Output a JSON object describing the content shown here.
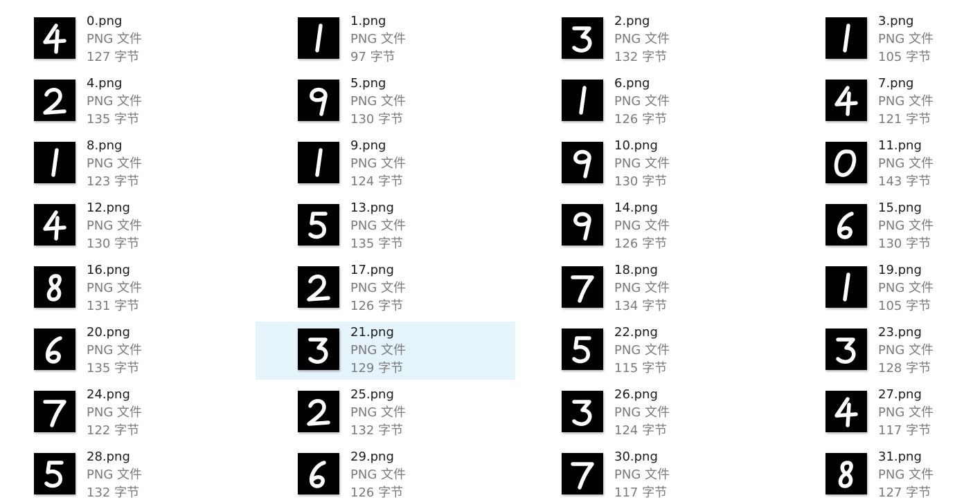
{
  "files": [
    {
      "name": "0.png",
      "type": "PNG 文件",
      "size": "127 字节",
      "digit": "4"
    },
    {
      "name": "1.png",
      "type": "PNG 文件",
      "size": "97 字节",
      "digit": "1"
    },
    {
      "name": "2.png",
      "type": "PNG 文件",
      "size": "132 字节",
      "digit": "3"
    },
    {
      "name": "3.png",
      "type": "PNG 文件",
      "size": "105 字节",
      "digit": "1"
    },
    {
      "name": "4.png",
      "type": "PNG 文件",
      "size": "135 字节",
      "digit": "2"
    },
    {
      "name": "5.png",
      "type": "PNG 文件",
      "size": "130 字节",
      "digit": "9"
    },
    {
      "name": "6.png",
      "type": "PNG 文件",
      "size": "126 字节",
      "digit": "1"
    },
    {
      "name": "7.png",
      "type": "PNG 文件",
      "size": "121 字节",
      "digit": "4"
    },
    {
      "name": "8.png",
      "type": "PNG 文件",
      "size": "123 字节",
      "digit": "1"
    },
    {
      "name": "9.png",
      "type": "PNG 文件",
      "size": "124 字节",
      "digit": "1"
    },
    {
      "name": "10.png",
      "type": "PNG 文件",
      "size": "130 字节",
      "digit": "9"
    },
    {
      "name": "11.png",
      "type": "PNG 文件",
      "size": "143 字节",
      "digit": "0"
    },
    {
      "name": "12.png",
      "type": "PNG 文件",
      "size": "130 字节",
      "digit": "4"
    },
    {
      "name": "13.png",
      "type": "PNG 文件",
      "size": "135 字节",
      "digit": "5"
    },
    {
      "name": "14.png",
      "type": "PNG 文件",
      "size": "126 字节",
      "digit": "9"
    },
    {
      "name": "15.png",
      "type": "PNG 文件",
      "size": "130 字节",
      "digit": "6"
    },
    {
      "name": "16.png",
      "type": "PNG 文件",
      "size": "131 字节",
      "digit": "8"
    },
    {
      "name": "17.png",
      "type": "PNG 文件",
      "size": "126 字节",
      "digit": "2"
    },
    {
      "name": "18.png",
      "type": "PNG 文件",
      "size": "134 字节",
      "digit": "7"
    },
    {
      "name": "19.png",
      "type": "PNG 文件",
      "size": "105 字节",
      "digit": "1"
    },
    {
      "name": "20.png",
      "type": "PNG 文件",
      "size": "135 字节",
      "digit": "6"
    },
    {
      "name": "21.png",
      "type": "PNG 文件",
      "size": "129 字节",
      "digit": "3",
      "selected": true
    },
    {
      "name": "22.png",
      "type": "PNG 文件",
      "size": "115 字节",
      "digit": "5"
    },
    {
      "name": "23.png",
      "type": "PNG 文件",
      "size": "128 字节",
      "digit": "3"
    },
    {
      "name": "24.png",
      "type": "PNG 文件",
      "size": "122 字节",
      "digit": "7"
    },
    {
      "name": "25.png",
      "type": "PNG 文件",
      "size": "132 字节",
      "digit": "2"
    },
    {
      "name": "26.png",
      "type": "PNG 文件",
      "size": "124 字节",
      "digit": "3"
    },
    {
      "name": "27.png",
      "type": "PNG 文件",
      "size": "117 字节",
      "digit": "4"
    },
    {
      "name": "28.png",
      "type": "PNG 文件",
      "size": "132 字节",
      "digit": "5"
    },
    {
      "name": "29.png",
      "type": "PNG 文件",
      "size": "126 字节",
      "digit": "6"
    },
    {
      "name": "30.png",
      "type": "PNG 文件",
      "size": "117 字节",
      "digit": "7"
    },
    {
      "name": "31.png",
      "type": "PNG 文件",
      "size": "127 字节",
      "digit": "8"
    }
  ],
  "colors": {
    "selection": "#e5f3fb",
    "thumbnail_bg": "#000000",
    "glyph": "#ffffff",
    "name_text": "#1a1a1a",
    "meta_text": "#7a7a7a"
  }
}
